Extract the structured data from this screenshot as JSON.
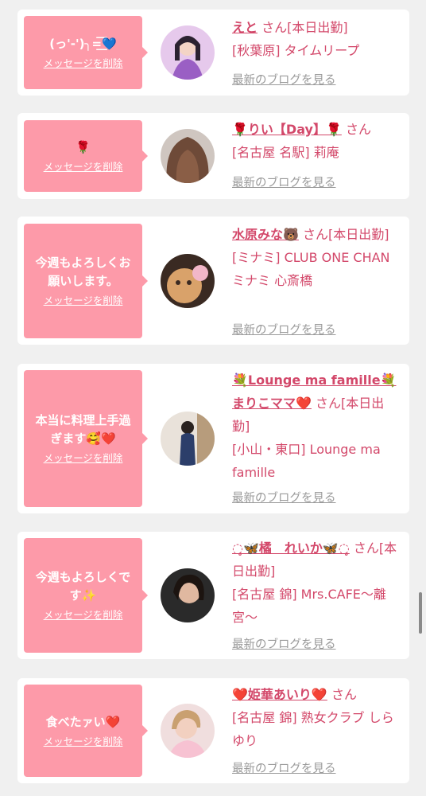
{
  "cards": [
    {
      "message": "(っ'-')╮=͟͟͞͞💙",
      "delete_label": "メッセージを削除",
      "name": "えと",
      "suffix": " さん[本日出勤]",
      "shop": "[秋葉原] タイムリープ",
      "blog_label": "最新のブログを見る"
    },
    {
      "message": "🌹",
      "delete_label": "メッセージを削除",
      "name": "🌹りい【Day】🌹",
      "suffix": " さん",
      "shop": "[名古屋 名駅] 莉庵",
      "blog_label": "最新のブログを見る"
    },
    {
      "message": "今週もよろしくお願いします。",
      "delete_label": "メッセージを削除",
      "name": "水原みな🐻",
      "suffix": " さん[本日出勤]",
      "shop": "[ミナミ] CLUB ONE CHAN ミナミ 心斎橋",
      "blog_label": "最新のブログを見る"
    },
    {
      "message": "本当に料理上手過ぎます🥰❤️",
      "delete_label": "メッセージを削除",
      "name": "💐Lounge ma famille💐まりこママ❤️",
      "suffix": " さん[本日出勤]",
      "shop": "[小山・東口] Lounge ma famille",
      "blog_label": "最新のブログを見る"
    },
    {
      "message": "今週もよろしくです✨",
      "delete_label": "メッセージを削除",
      "name": "◌̥🦋橘　れいか🦋◌̥",
      "suffix": " さん[本日出勤]",
      "shop": "[名古屋 錦] Mrs.CAFE〜離宮〜",
      "blog_label": "最新のブログを見る"
    },
    {
      "message": "食べたァい❤️",
      "delete_label": "メッセージを削除",
      "name": "❤️姫華あいり❤️",
      "suffix": " さん",
      "shop": "[名古屋 錦] 熟女クラブ しらゆり",
      "blog_label": "最新のブログを見る"
    }
  ],
  "colors": {
    "bubble": "#fd9aa9",
    "link": "#d3486a",
    "muted": "#9a9a9a",
    "background": "#f0f0f0"
  }
}
